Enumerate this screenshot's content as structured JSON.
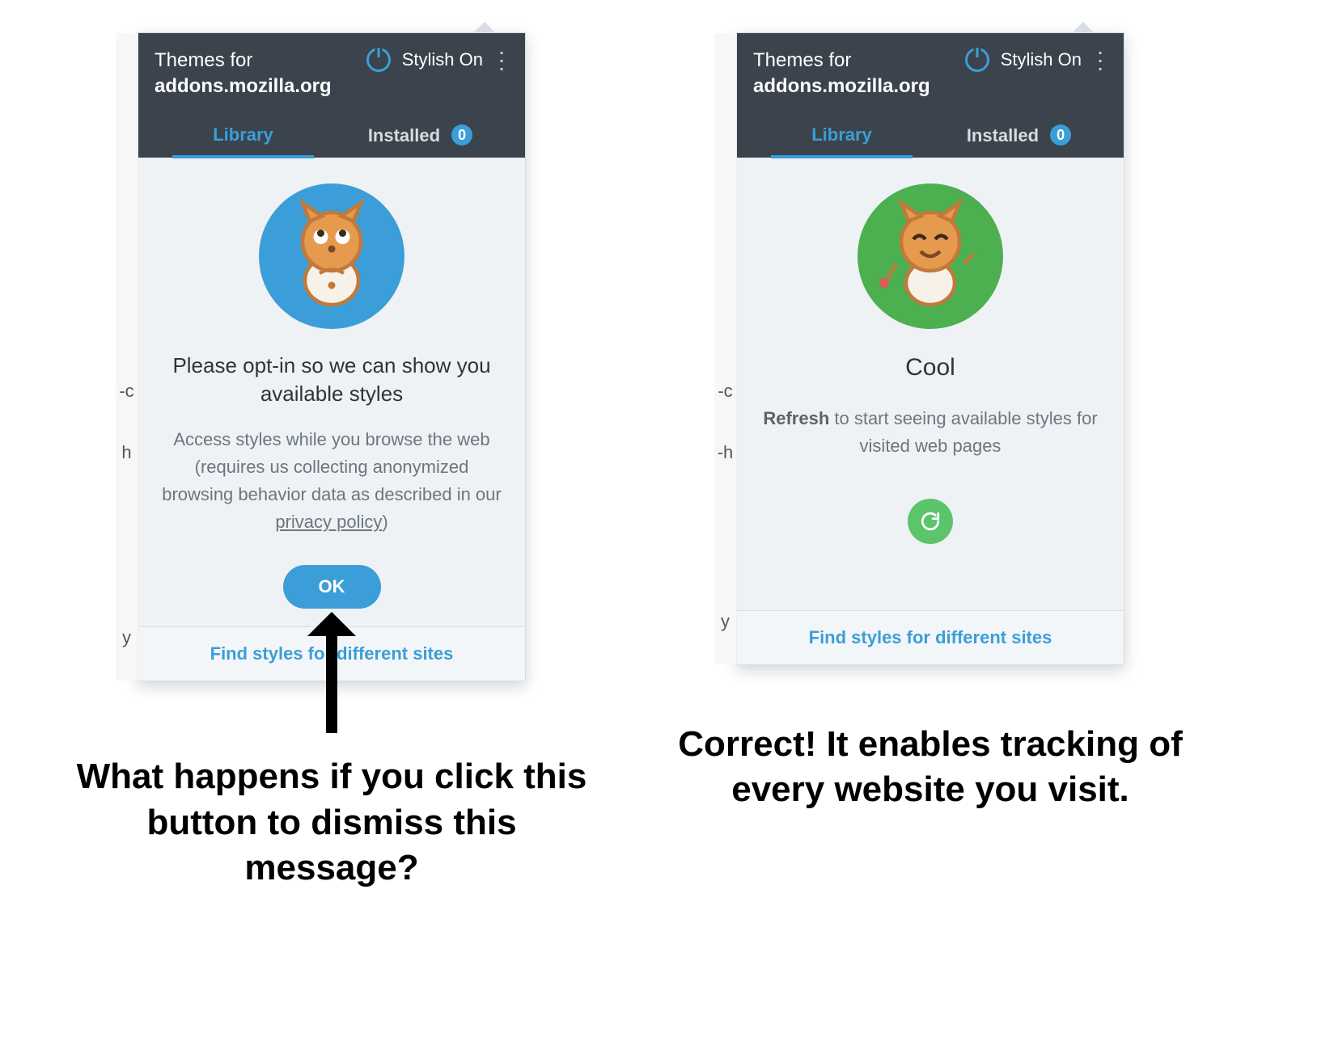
{
  "popups": {
    "left": {
      "header": {
        "title_line1": "Themes for",
        "title_line2": "addons.mozilla.org",
        "toggle_label": "Stylish On"
      },
      "tabs": {
        "library": "Library",
        "installed": "Installed",
        "installed_count": "0"
      },
      "body": {
        "title": "Please opt-in so we can show you available styles",
        "subtitle_a": "Access styles while you browse the web (requires us collecting anonymized browsing behavior data as described in our ",
        "privacy_link": "privacy policy",
        "subtitle_b": ")",
        "ok_label": "OK"
      },
      "footer_link": "Find styles for different sites",
      "behind_chars": [
        "-c",
        "h",
        "y"
      ]
    },
    "right": {
      "header": {
        "title_line1": "Themes for",
        "title_line2": "addons.mozilla.org",
        "toggle_label": "Stylish On"
      },
      "tabs": {
        "library": "Library",
        "installed": "Installed",
        "installed_count": "0"
      },
      "body": {
        "title": "Cool",
        "sub_bold": "Refresh",
        "sub_rest": " to start seeing available styles for visited web pages"
      },
      "footer_link": "Find styles for different sites",
      "behind_chars": [
        "-c",
        "-h",
        "y"
      ]
    }
  },
  "captions": {
    "left": "What happens if you click this button to dismiss this message?",
    "right": "Correct! It enables tracking of every website you visit."
  }
}
